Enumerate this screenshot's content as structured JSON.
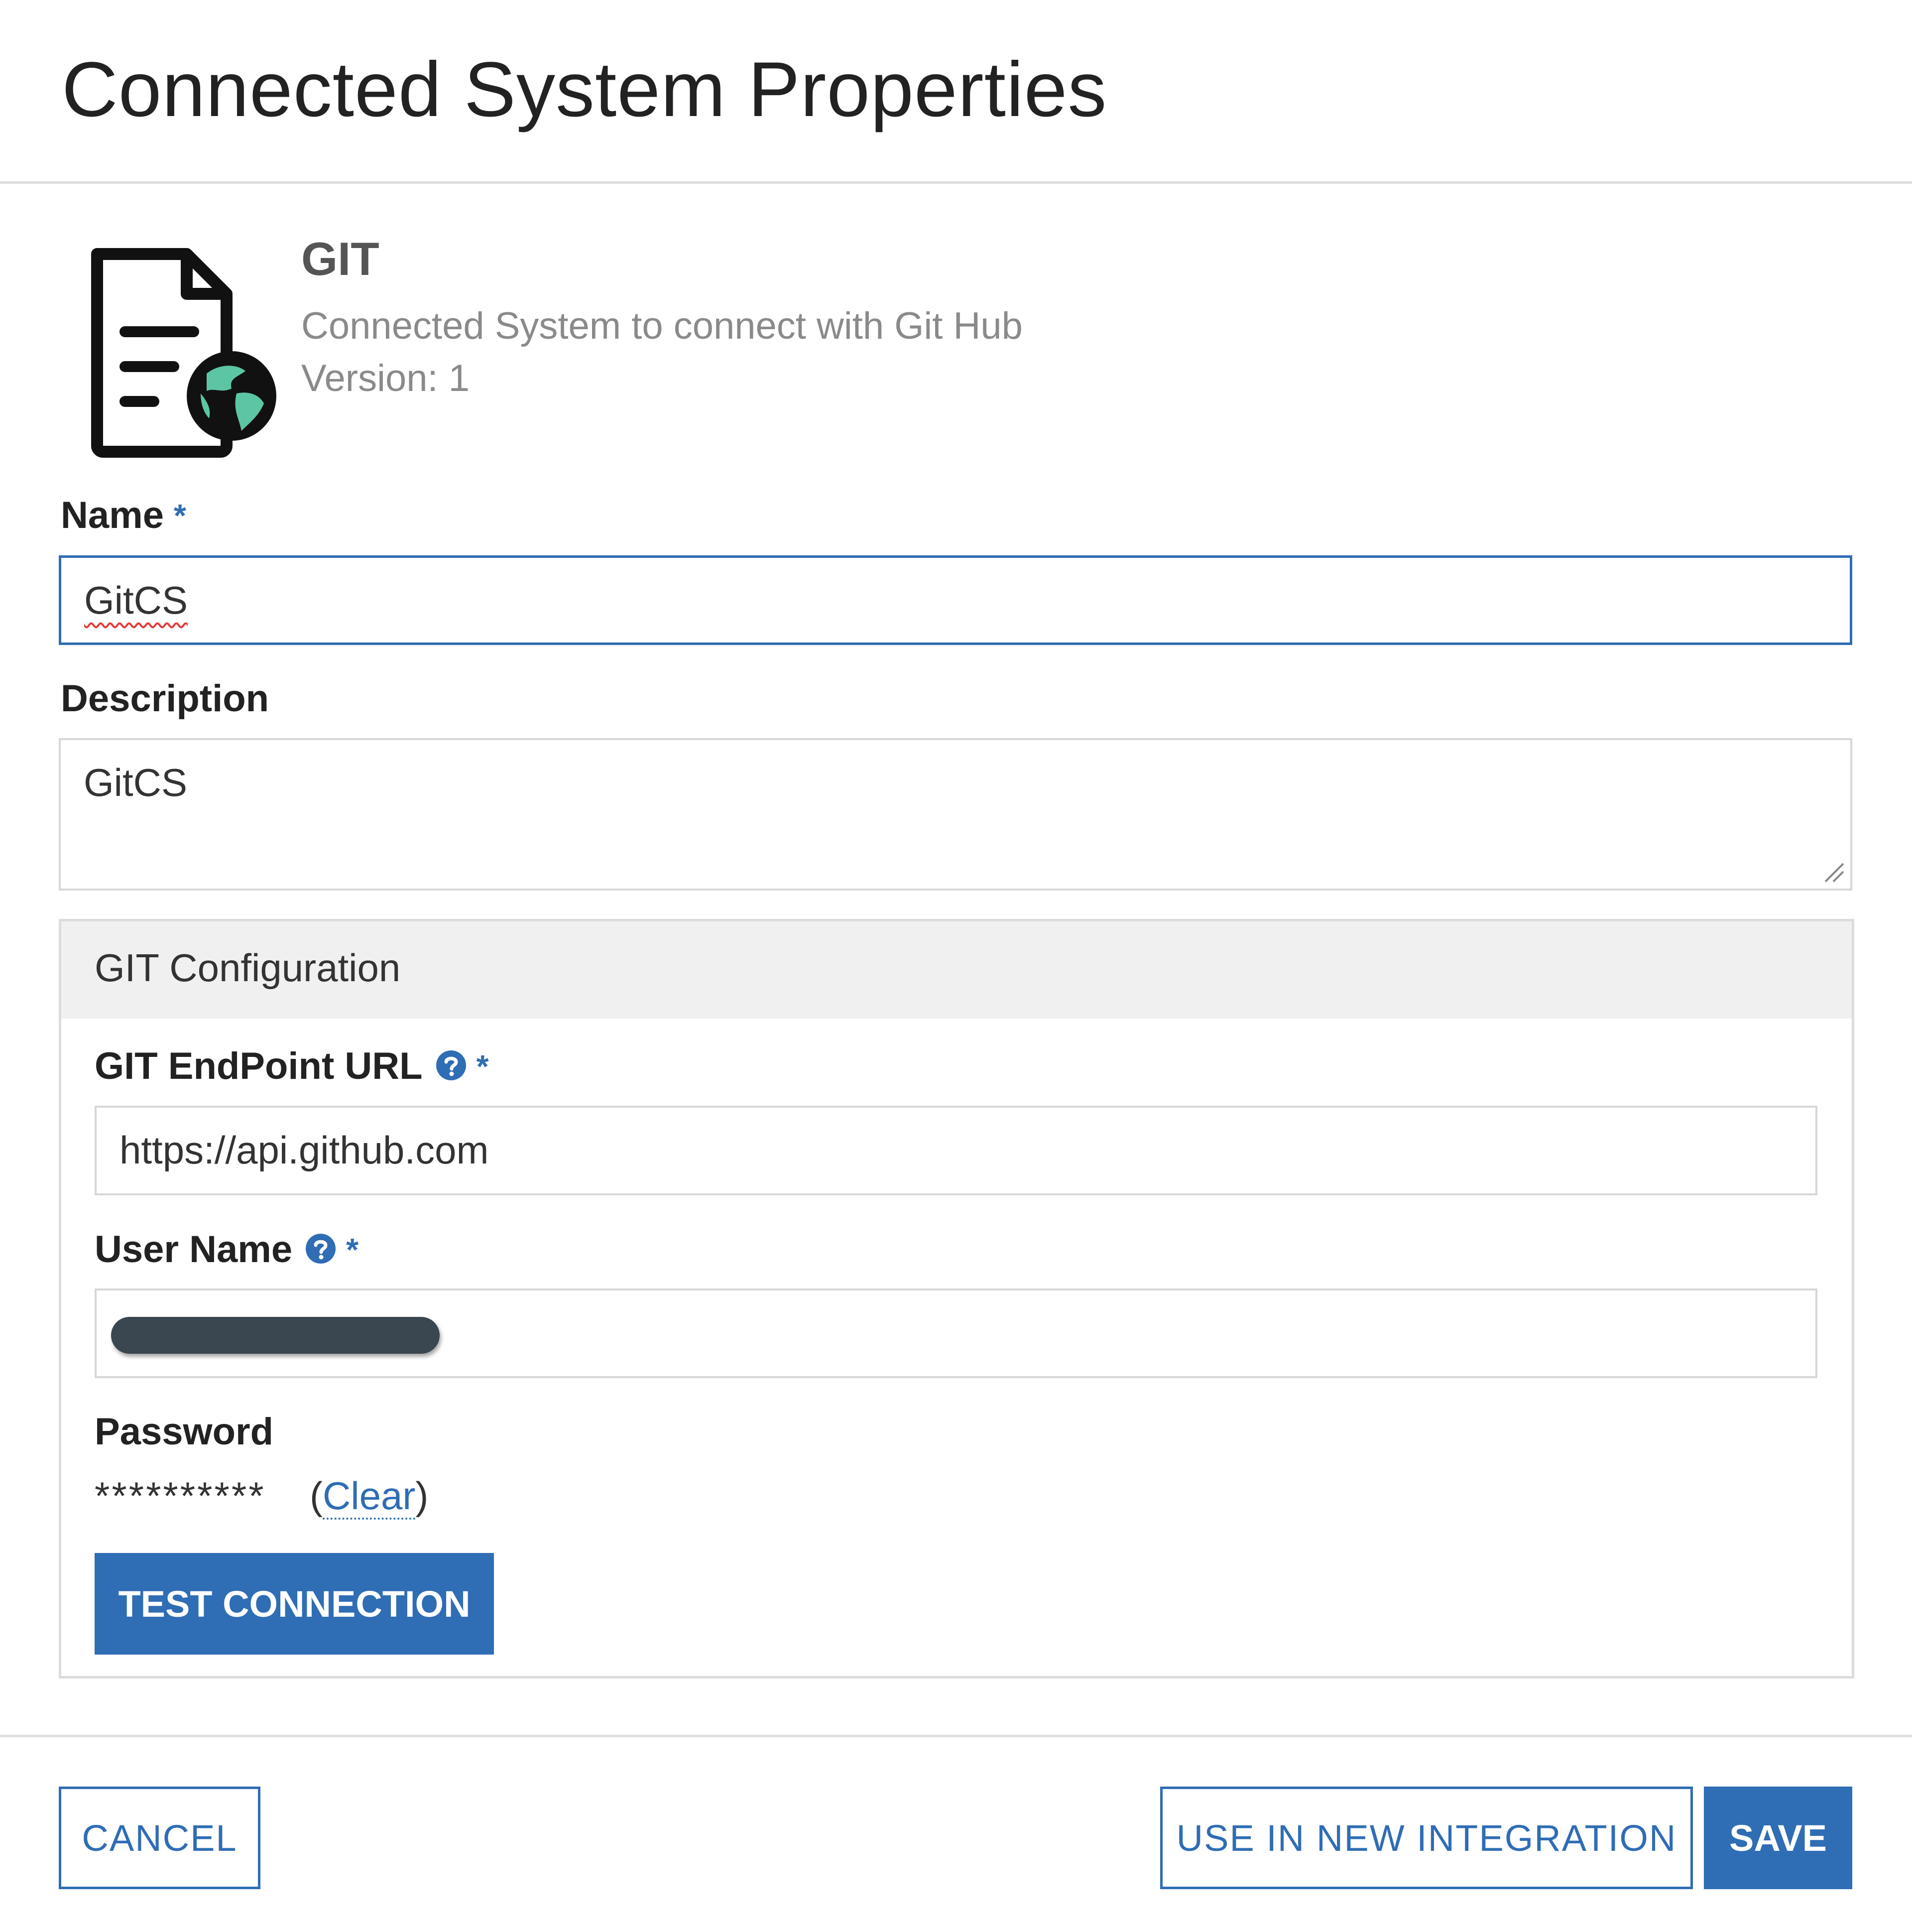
{
  "dialog": {
    "title": "Connected System Properties"
  },
  "system": {
    "name": "GIT",
    "description": "Connected System to connect with Git Hub",
    "version": "Version: 1",
    "icon": "document-globe-icon",
    "icon_accent_color": "#5cc6a4"
  },
  "form": {
    "name_label": "Name",
    "name_value": "GitCS",
    "description_label": "Description",
    "description_value": "GitCS",
    "required_marker": "*"
  },
  "git_config": {
    "section_title": "GIT Configuration",
    "endpoint_label": "GIT EndPoint URL",
    "endpoint_value": "https://api.github.com",
    "username_label": "User Name",
    "password_label": "Password",
    "password_mask": "**********",
    "clear_open": "(",
    "clear_link": "Clear",
    "clear_close": ")",
    "test_button": "TEST CONNECTION"
  },
  "footer": {
    "cancel_button": "CANCEL",
    "use_in_new_integration_button": "USE IN NEW INTEGRATION",
    "save_button": "SAVE"
  },
  "colors": {
    "primary": "#2f6db5",
    "border": "#d7d7d7",
    "section_header_bg": "#f0f0f0"
  }
}
